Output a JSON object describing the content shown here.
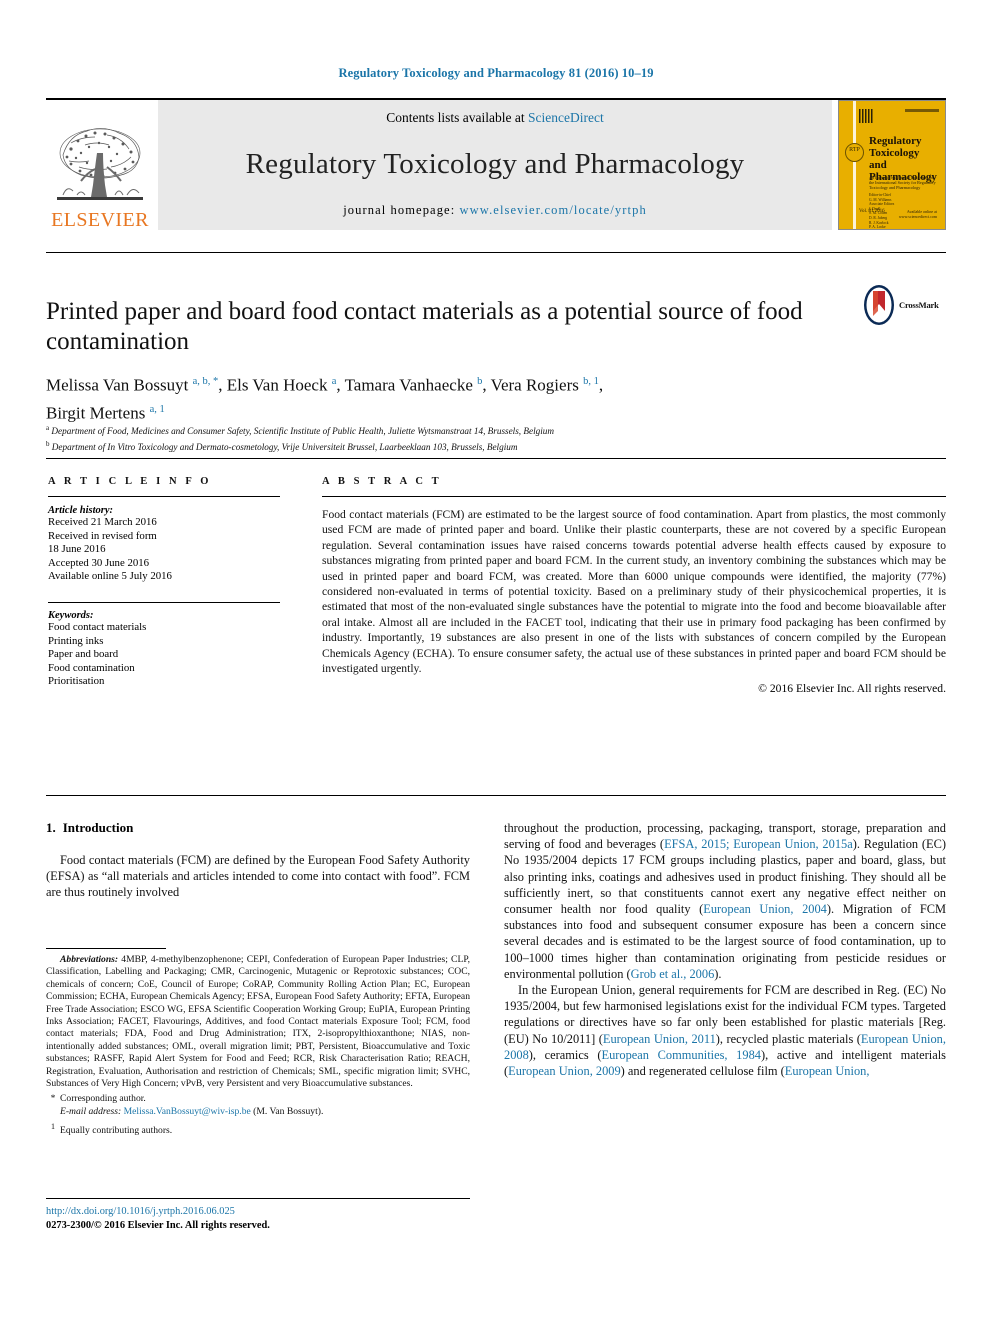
{
  "running_head": "Regulatory Toxicology and Pharmacology 81 (2016) 10–19",
  "masthead": {
    "publisher_logo_text": "ELSEVIER",
    "contents_prefix": "Contents lists available at ",
    "contents_link": "ScienceDirect",
    "journal_name": "Regulatory Toxicology and Pharmacology",
    "homepage_prefix": "journal homepage: ",
    "homepage_url": "www.elsevier.com/locate/yrtph",
    "cover": {
      "title_line1": "Regulatory",
      "title_line2": "Toxicology and",
      "title_line3": "Pharmacology",
      "subtitle": "An International Journal Published for the International Society for Regulatory Toxicology and Pharmacology",
      "badge": "RTP",
      "editor_list": "Editor-in-Chief\nG. M. Williams\nAssociate Editors\nJ. Doull\nS. M. Cohen\nD. R. Juberg\nR. J. Kavlock\nP. A. Locke",
      "volume_note": "Vol. 81\n2016",
      "footer": "Available online at\nwww.sciencedirect.com"
    }
  },
  "article": {
    "title": "Printed paper and board food contact materials as a potential source of food contamination",
    "crossmark_label": "CrossMark",
    "authors_html": "Melissa Van Bossuyt <sup>a, b, *</sup>, Els Van Hoeck <sup>a</sup>, Tamara Vanhaecke <sup>b</sup>, Vera Rogiers <sup>b, 1</sup>, Birgit Mertens <sup>a, 1</sup>",
    "affiliations": [
      {
        "mark": "a",
        "text": "Department of Food, Medicines and Consumer Safety, Scientific Institute of Public Health, Juliette Wytsmanstraat 14, Brussels, Belgium"
      },
      {
        "mark": "b",
        "text": "Department of In Vitro Toxicology and Dermato-cosmetology, Vrije Universiteit Brussel, Laarbeeklaan 103, Brussels, Belgium"
      }
    ]
  },
  "article_info": {
    "heading": "A R T I C L E   I N F O",
    "history_label": "Article history:",
    "history": [
      "Received 21 March 2016",
      "Received in revised form",
      "18 June 2016",
      "Accepted 30 June 2016",
      "Available online 5 July 2016"
    ],
    "keywords_label": "Keywords:",
    "keywords": [
      "Food contact materials",
      "Printing inks",
      "Paper and board",
      "Food contamination",
      "Prioritisation"
    ]
  },
  "abstract": {
    "heading": "A B S T R A C T",
    "text": "Food contact materials (FCM) are estimated to be the largest source of food contamination. Apart from plastics, the most commonly used FCM are made of printed paper and board. Unlike their plastic counterparts, these are not covered by a specific European regulation. Several contamination issues have raised concerns towards potential adverse health effects caused by exposure to substances migrating from printed paper and board FCM. In the current study, an inventory combining the substances which may be used in printed paper and board FCM, was created. More than 6000 unique compounds were identified, the majority (77%) considered non-evaluated in terms of potential toxicity. Based on a preliminary study of their physicochemical properties, it is estimated that most of the non-evaluated single substances have the potential to migrate into the food and become bioavailable after oral intake. Almost all are included in the FACET tool, indicating that their use in primary food packaging has been confirmed by industry. Importantly, 19 substances are also present in one of the lists with substances of concern compiled by the European Chemicals Agency (ECHA). To ensure consumer safety, the actual use of these substances in printed paper and board FCM should be investigated urgently.",
    "copyright": "© 2016 Elsevier Inc. All rights reserved."
  },
  "body": {
    "section_number": "1.",
    "section_title": "Introduction",
    "left_paragraph": "Food contact materials (FCM) are defined by the European Food Safety Authority (EFSA) as “all materials and articles intended to come into contact with food”. FCM are thus routinely involved",
    "right_paragraph_1_a": "throughout the production, processing, packaging, transport, storage, preparation and serving of food and beverages (",
    "right_ref_1": "EFSA, 2015; European Union, 2015a",
    "right_paragraph_1_b": "). Regulation (EC) No 1935/2004 depicts 17 FCM groups including plastics, paper and board, glass, but also printing inks, coatings and adhesives used in product finishing. They should all be sufficiently inert, so that constituents cannot exert any negative effect neither on consumer health nor food quality (",
    "right_ref_2": "European Union, 2004",
    "right_paragraph_1_c": "). Migration of FCM substances into food and subsequent consumer exposure has been a concern since several decades and is estimated to be the largest source of food contamination, up to 100–1000 times higher than contamination originating from pesticide residues or environmental pollution (",
    "right_ref_3": "Grob et al., 2006",
    "right_paragraph_1_d": ").",
    "right_paragraph_2_a": "In the European Union, general requirements for FCM are described in Reg. (EC) No 1935/2004, but few harmonised legislations exist for the individual FCM types. Targeted regulations or directives have so far only been established for plastic materials [Reg. (EU) No 10/2011] (",
    "right_ref_4": "European Union, 2011",
    "right_paragraph_2_b": "), recycled plastic materials (",
    "right_ref_5": "European Union, 2008",
    "right_paragraph_2_c": "), ceramics (",
    "right_ref_6": "European Communities, 1984",
    "right_paragraph_2_d": "), active and intelligent materials (",
    "right_ref_7": "European Union, 2009",
    "right_paragraph_2_e": ") and regenerated cellulose film (",
    "right_ref_8": "European Union,",
    "right_paragraph_2_f": ""
  },
  "footnotes": {
    "abbreviations_label": "Abbreviations:",
    "abbreviations_text": " 4MBP, 4-methylbenzophenone; CEPI, Confederation of European Paper Industries; CLP, Classification, Labelling and Packaging; CMR, Carcinogenic, Mutagenic or Reprotoxic substances; COC, chemicals of concern; CoE, Council of Europe; CoRAP, Community Rolling Action Plan; EC, European Commission; ECHA, European Chemicals Agency; EFSA, European Food Safety Authority; EFTA, European Free Trade Association; ESCO WG, EFSA Scientific Cooperation Working Group; EuPIA, European Printing Inks Association; FACET, Flavourings, Additives, and food Contact materials Exposure Tool; FCM, food contact materials; FDA, Food and Drug Administration; ITX, 2-isopropylthioxanthone; NIAS, non-intentionally added substances; OML, overall migration limit; PBT, Persistent, Bioaccumulative and Toxic substances; RASFF, Rapid Alert System for Food and Feed; RCR, Risk Characterisation Ratio; REACH, Registration, Evaluation, Authorisation and restriction of Chemicals; SML, specific migration limit; SVHC, Substances of Very High Concern; vPvB, very Persistent and very Bioaccumulative substances.",
    "corresponding_mark": "*",
    "corresponding_text": "Corresponding author.",
    "email_label": "E-mail address:",
    "email_address": "Melissa.VanBossuyt@wiv-isp.be",
    "email_owner": "(M. Van Bossuyt).",
    "equal_mark": "1",
    "equal_text": "Equally contributing authors."
  },
  "footer": {
    "doi_url": "http://dx.doi.org/10.1016/j.yrtph.2016.06.025",
    "issn_line_a": "0273-2300/",
    "issn_copyright": "© 2016 Elsevier Inc. All rights reserved."
  },
  "colors": {
    "link": "#1b75a8",
    "elsevier_orange": "#E87722",
    "cover_yellow": "#E8AF00",
    "band_gray": "#e9e9e9"
  }
}
